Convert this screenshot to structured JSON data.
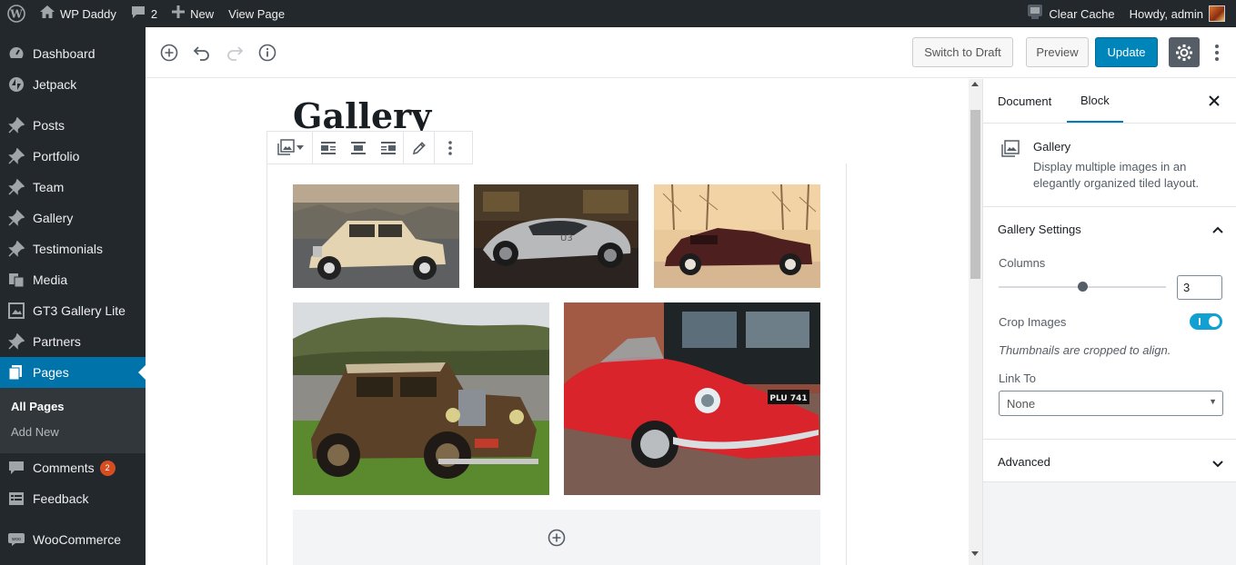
{
  "adminbar": {
    "site_name": "WP Daddy",
    "comments_count": "2",
    "new_label": "New",
    "view_page_label": "View Page",
    "clear_cache_label": "Clear Cache",
    "howdy_label": "Howdy, admin"
  },
  "sidebar": {
    "items": [
      {
        "label": "Dashboard",
        "icon": "dashboard-icon"
      },
      {
        "label": "Jetpack",
        "icon": "jetpack-icon"
      },
      {
        "label": "Posts",
        "icon": "pin-icon"
      },
      {
        "label": "Portfolio",
        "icon": "pin-icon"
      },
      {
        "label": "Team",
        "icon": "pin-icon"
      },
      {
        "label": "Gallery",
        "icon": "pin-icon"
      },
      {
        "label": "Testimonials",
        "icon": "pin-icon"
      },
      {
        "label": "Media",
        "icon": "media-icon"
      },
      {
        "label": "GT3 Gallery Lite",
        "icon": "gallery-icon"
      },
      {
        "label": "Partners",
        "icon": "pin-icon"
      },
      {
        "label": "Pages",
        "icon": "pages-icon"
      },
      {
        "label": "Comments",
        "icon": "comment-icon",
        "badge": "2"
      },
      {
        "label": "Feedback",
        "icon": "feedback-icon"
      },
      {
        "label": "WooCommerce",
        "icon": "woo-icon"
      }
    ],
    "submenu": {
      "all_pages": "All Pages",
      "add_new": "Add New"
    }
  },
  "editor_header": {
    "switch_to_draft": "Switch to Draft",
    "preview": "Preview",
    "update": "Update"
  },
  "post": {
    "title": "Gallery"
  },
  "gallery": {
    "images": [
      {
        "name": "gallery-image-beige-classic-car"
      },
      {
        "name": "gallery-image-silver-concept-car"
      },
      {
        "name": "gallery-image-maroon-convertible"
      },
      {
        "name": "gallery-image-brown-vintage-car"
      },
      {
        "name": "gallery-image-red-jaguar"
      }
    ],
    "red_car_plate": "PLU 741"
  },
  "inspector": {
    "tab_document": "Document",
    "tab_block": "Block",
    "block_name": "Gallery",
    "block_description": "Display multiple images in an elegantly organized tiled layout.",
    "gallery_settings_title": "Gallery Settings",
    "columns_label": "Columns",
    "columns_value": "3",
    "crop_images_label": "Crop Images",
    "crop_images_enabled": true,
    "crop_help": "Thumbnails are cropped to align.",
    "link_to_label": "Link To",
    "link_to_value": "None",
    "advanced_title": "Advanced"
  },
  "colors": {
    "admin_dark": "#23282d",
    "active_blue": "#0073aa",
    "primary_button": "#0085ba",
    "toggle_on": "#11a0d2",
    "badge": "#d54e21"
  }
}
